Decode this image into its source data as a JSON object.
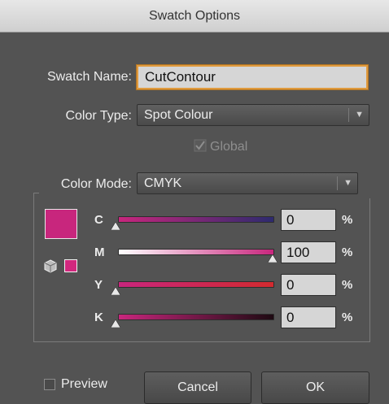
{
  "window": {
    "title": "Swatch Options"
  },
  "swatch_name": {
    "label": "Swatch Name:",
    "value": "CutContour"
  },
  "color_type": {
    "label": "Color Type:",
    "value": "Spot Colour"
  },
  "global": {
    "label": "Global",
    "checked": true,
    "enabled": false
  },
  "color_mode": {
    "label": "Color Mode:",
    "value": "CMYK"
  },
  "channels": [
    {
      "letter": "C",
      "value": "0",
      "unit": "%"
    },
    {
      "letter": "M",
      "value": "100",
      "unit": "%"
    },
    {
      "letter": "Y",
      "value": "0",
      "unit": "%"
    },
    {
      "letter": "K",
      "value": "0",
      "unit": "%"
    }
  ],
  "preview": {
    "label": "Preview",
    "checked": false
  },
  "buttons": {
    "cancel": "Cancel",
    "ok": "OK"
  },
  "colors": {
    "swatch": "#c8267d",
    "focus": "#e09a3d"
  },
  "icons": {
    "out_of_gamut": "cube-icon",
    "dropdown": "triangle-down-icon",
    "check": "checkmark-icon"
  }
}
